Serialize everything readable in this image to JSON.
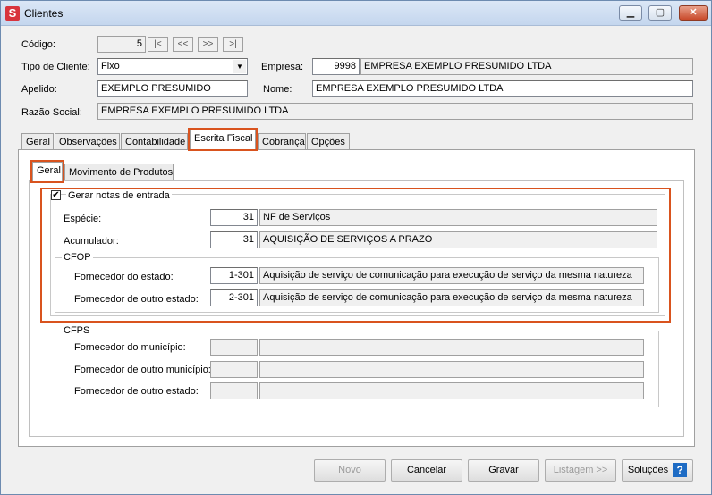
{
  "window": {
    "title": "Clientes",
    "minimize": "▁",
    "maximize": "▢",
    "close": "✕"
  },
  "form": {
    "codigo_label": "Código:",
    "codigo_value": "5",
    "nav": [
      "|<",
      "<<",
      ">>",
      ">|"
    ],
    "tipo_label": "Tipo de Cliente:",
    "tipo_value": "Fixo",
    "empresa_label": "Empresa:",
    "empresa_code": "9998",
    "empresa_name": "EMPRESA EXEMPLO PRESUMIDO LTDA",
    "apelido_label": "Apelido:",
    "apelido_value": "EXEMPLO PRESUMIDO",
    "nome_label": "Nome:",
    "nome_value": "EMPRESA EXEMPLO PRESUMIDO LTDA",
    "razao_label": "Razão Social:",
    "razao_value": "EMPRESA EXEMPLO PRESUMIDO LTDA"
  },
  "tabs": [
    "Geral",
    "Observações",
    "Contabilidade",
    "Escrita Fiscal",
    "Cobrança",
    "Opções"
  ],
  "subtabs": [
    "Geral",
    "Movimento de Produtos"
  ],
  "fiscal": {
    "gerar_label": "Gerar notas de entrada",
    "gerar_checked": "✔",
    "especie_label": "Espécie:",
    "especie_code": "31",
    "especie_desc": "NF de Serviços",
    "acumulador_label": "Acumulador:",
    "acumulador_code": "31",
    "acumulador_desc": "AQUISIÇÃO DE SERVIÇOS A PRAZO",
    "cfop_title": "CFOP",
    "forn_estado_label": "Fornecedor do estado:",
    "forn_estado_code": "1-301",
    "forn_estado_desc": "Aquisição de serviço de comunicação para execução de serviço da mesma natureza",
    "forn_outro_estado_label": "Fornecedor de outro estado:",
    "forn_outro_estado_code": "2-301",
    "forn_outro_estado_desc": "Aquisição de serviço de comunicação para execução de serviço da mesma natureza",
    "cfps_title": "CFPS",
    "cfps_municipio_label": "Fornecedor do município:",
    "cfps_outro_municipio_label": "Fornecedor de outro município:",
    "cfps_outro_estado_label": "Fornecedor de outro estado:"
  },
  "buttons": {
    "novo": "Novo",
    "cancelar": "Cancelar",
    "gravar": "Gravar",
    "listagem": "Listagem >>",
    "solucoes": "Soluções",
    "help": "?"
  },
  "colors": {
    "highlight": "#d9531e",
    "help": "#1d6bc4"
  }
}
